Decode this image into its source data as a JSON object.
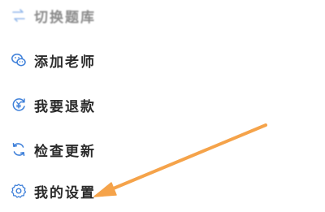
{
  "menu": {
    "items": [
      {
        "label": "切换题库",
        "icon": "switch-bank-icon"
      },
      {
        "label": "添加老师",
        "icon": "wechat-icon"
      },
      {
        "label": "我要退款",
        "icon": "refund-icon"
      },
      {
        "label": "检查更新",
        "icon": "refresh-icon"
      },
      {
        "label": "我的设置",
        "icon": "settings-gear-icon"
      }
    ]
  },
  "colors": {
    "icon": "#3d7fd9",
    "text": "#2b2b2b",
    "annotation_arrow": "#f5a34a",
    "background": "#ffffff"
  },
  "annotation": {
    "type": "arrow",
    "points_to": "我的设置"
  }
}
